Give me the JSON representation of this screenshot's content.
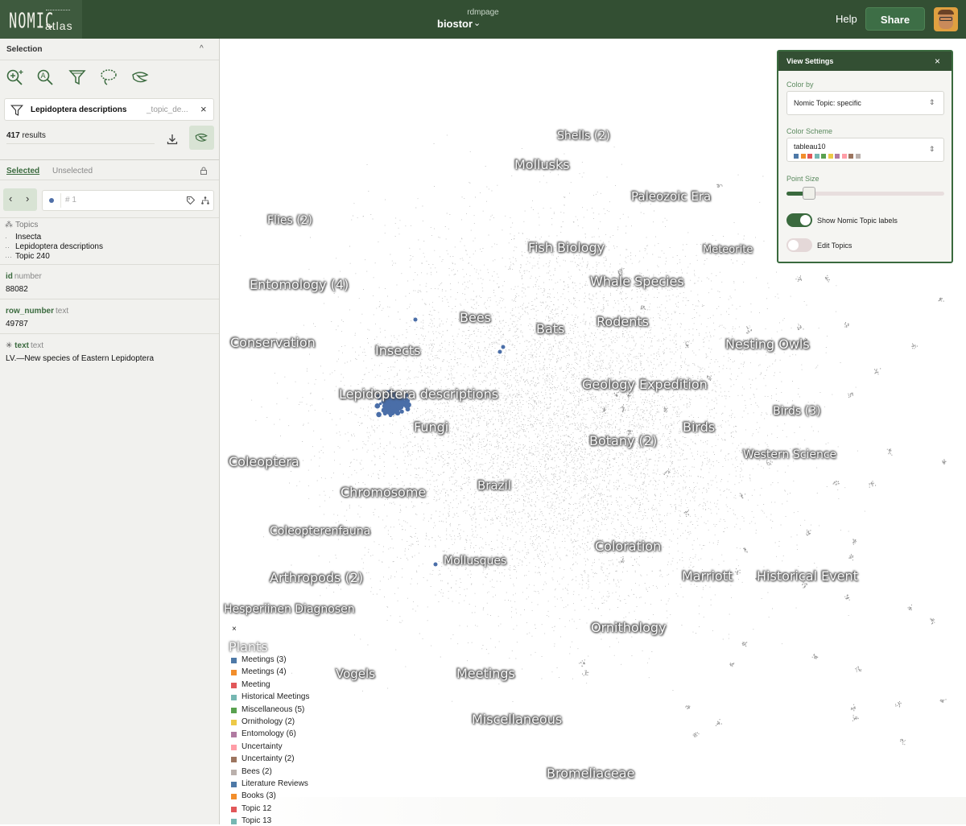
{
  "header": {
    "logo_top": "NOMIC",
    "logo_bottom": "atlas",
    "owner": "rdmpage",
    "project": "biostor",
    "project_caret": "⌄",
    "help": "Help",
    "share": "Share"
  },
  "selection": {
    "title": "Selection",
    "collapse": "^",
    "filter_name": "Lepidoptera descriptions",
    "filter_field": "_topic_de...",
    "filter_close": "×",
    "results_count": "417",
    "results_label": "results",
    "tab_selected": "Selected",
    "tab_unselected": "Unselected",
    "record_num": "# 1"
  },
  "record": {
    "topics_label": "Topics",
    "topics": [
      "Insecta",
      "Lepidoptera descriptions",
      "Topic 240"
    ],
    "fields": [
      {
        "name": "id",
        "type": "number",
        "value": "88082"
      },
      {
        "name": "row_number",
        "type": "text",
        "value": "49787"
      },
      {
        "name": "text",
        "type": "text",
        "value": "LV.—New species of Eastern Lepidoptera"
      }
    ]
  },
  "view_settings": {
    "title": "View Settings",
    "close": "×",
    "color_by_label": "Color by",
    "color_by_value": "Nomic Topic: specific",
    "scheme_label": "Color Scheme",
    "scheme_value": "tableau10",
    "scheme_colors": [
      "#4e79a7",
      "#f28e2b",
      "#e15759",
      "#76b7b2",
      "#59a14f",
      "#edc948",
      "#b07aa1",
      "#ff9da7",
      "#9c755f",
      "#bab0ac"
    ],
    "point_size_label": "Point Size",
    "point_size_level": 0.1,
    "show_labels": "Show Nomic Topic labels",
    "show_labels_on": true,
    "edit_topics": "Edit Topics",
    "edit_topics_on": false
  },
  "map_labels": [
    {
      "text": "Shells (2)",
      "size": 14
    },
    {
      "text": "Mollusks",
      "size": 16
    },
    {
      "text": "Paleozoic Era",
      "size": 15
    },
    {
      "text": "Flies (2)",
      "size": 14
    },
    {
      "text": "Fish Biology",
      "size": 16
    },
    {
      "text": "Meteorite",
      "size": 13
    },
    {
      "text": "Entomology (4)",
      "size": 16
    },
    {
      "text": "Whale Species",
      "size": 16
    },
    {
      "text": "Bees",
      "size": 16
    },
    {
      "text": "Bats",
      "size": 16
    },
    {
      "text": "Rodents",
      "size": 16
    },
    {
      "text": "Conservation",
      "size": 16
    },
    {
      "text": "Nesting Owls",
      "size": 16
    },
    {
      "text": "Insects",
      "size": 16
    },
    {
      "text": "Geology Expedition",
      "size": 16
    },
    {
      "text": "Lepidoptera descriptions",
      "size": 16
    },
    {
      "text": "Birds (3)",
      "size": 14
    },
    {
      "text": "Fungi",
      "size": 16
    },
    {
      "text": "Birds",
      "size": 16
    },
    {
      "text": "Botany (2)",
      "size": 16
    },
    {
      "text": "Western Science",
      "size": 14
    },
    {
      "text": "Coleoptera",
      "size": 16
    },
    {
      "text": "Chromosome",
      "size": 16
    },
    {
      "text": "Brazil",
      "size": 15
    },
    {
      "text": "Coleopterenfauna",
      "size": 14
    },
    {
      "text": "Mollusques",
      "size": 14
    },
    {
      "text": "Coloration",
      "size": 16
    },
    {
      "text": "Arthropods (2)",
      "size": 16
    },
    {
      "text": "Marriott",
      "size": 16
    },
    {
      "text": "Historical Event",
      "size": 16
    },
    {
      "text": "Hesperiinen Diagnosen",
      "size": 14
    },
    {
      "text": "Ornithology",
      "size": 16
    },
    {
      "text": "Vogels",
      "size": 15
    },
    {
      "text": "Meetings",
      "size": 16
    },
    {
      "text": "Miscellaneous",
      "size": 16
    },
    {
      "text": "Bromeliaceae",
      "size": 16
    }
  ],
  "legend": {
    "close": "×",
    "title": "Plants",
    "items": [
      {
        "label": "Meetings (3)",
        "color": "#4e79a7"
      },
      {
        "label": "Meetings (4)",
        "color": "#f28e2b"
      },
      {
        "label": "Meeting",
        "color": "#e15759"
      },
      {
        "label": "Historical Meetings",
        "color": "#76b7b2"
      },
      {
        "label": "Miscellaneous (5)",
        "color": "#59a14f"
      },
      {
        "label": "Ornithology (2)",
        "color": "#edc948"
      },
      {
        "label": "Entomology (6)",
        "color": "#b07aa1"
      },
      {
        "label": "Uncertainty",
        "color": "#ff9da7"
      },
      {
        "label": "Uncertainty (2)",
        "color": "#9c755f"
      },
      {
        "label": "Bees (2)",
        "color": "#bab0ac"
      },
      {
        "label": "Literature Reviews",
        "color": "#4e79a7"
      },
      {
        "label": "Books (3)",
        "color": "#f28e2b"
      },
      {
        "label": "Topic 12",
        "color": "#e15759"
      },
      {
        "label": "Topic 13",
        "color": "#76b7b2"
      }
    ]
  },
  "colors": {
    "brand_dark": "#334f33",
    "accent": "#3a6a3e",
    "selected_points": "#4a6ea8"
  }
}
